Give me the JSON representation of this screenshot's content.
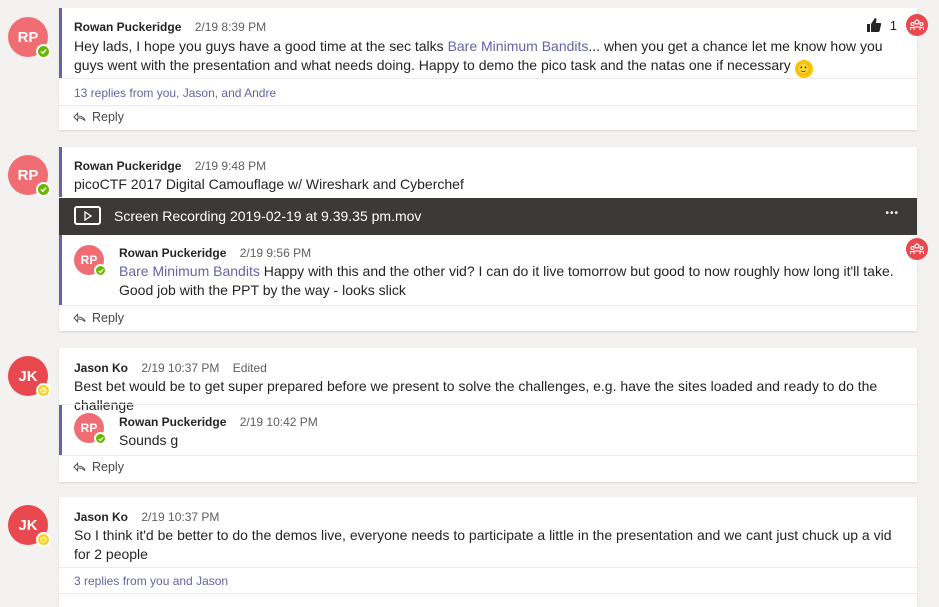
{
  "threads": [
    {
      "avatar": "RP",
      "author": "Rowan Puckeridge",
      "time": "2/19 8:39 PM",
      "body_pre": "Hey lads, I hope you guys have a good time at the sec talks ",
      "mention": "Bare Minimum Bandits",
      "body_post": "... when you get a chance let me know how you guys went with the presentation and what needs doing. Happy to demo the pico task and the natas one if necessary",
      "emoji": "🙂",
      "like_count": "1",
      "replies_link": "13 replies from you, Jason, and Andre",
      "reply_label": "Reply"
    },
    {
      "avatar": "RP",
      "author": "Rowan Puckeridge",
      "time": "2/19 9:48 PM",
      "body": "picoCTF 2017 Digital Camouflage w/ Wireshark and Cyberchef",
      "attachment": "Screen Recording 2019-02-19 at 9.39.35 pm.mov",
      "attachment_more": "•••",
      "reply": {
        "avatar": "RP",
        "author": "Rowan Puckeridge",
        "time": "2/19 9:56 PM",
        "mention": "Bare Minimum Bandits",
        "body": " Happy with this and the other vid? I can do it live tomorrow but good to now roughly how long it'll take. Good job with the PPT by the way - looks slick"
      },
      "reply_label": "Reply"
    },
    {
      "avatar": "JK",
      "author": "Jason Ko",
      "time": "2/19 10:37 PM",
      "edited": "Edited",
      "body": "Best bet would be to get super prepared before we present to solve the challenges, e.g. have the sites loaded and ready to do the challenge",
      "reply": {
        "avatar": "RP",
        "author": "Rowan Puckeridge",
        "time": "2/19 10:42 PM",
        "body": "Sounds g"
      },
      "reply_label": "Reply"
    },
    {
      "avatar": "JK",
      "author": "Jason Ko",
      "time": "2/19 10:37 PM",
      "body": "So I think it'd be better to do the demos live, everyone needs to participate a little in the presentation and we cant just chuck up a vid for 2 people",
      "replies_link": "3 replies from you and Jason"
    }
  ]
}
